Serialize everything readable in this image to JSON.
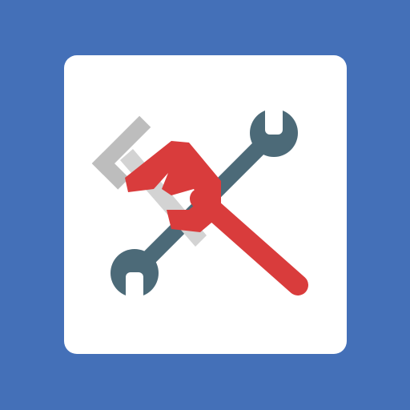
{
  "icon": {
    "name": "tools",
    "depicts": [
      "pipe-wrench-icon",
      "combination-wrench-icon"
    ],
    "colors": {
      "background": "#4470B8",
      "card": "#FFFFFF",
      "wrench": "#4C6A78",
      "pipe_wrench_body": "#D93C3C",
      "pipe_wrench_jaw": "#BDBDBD",
      "pipe_wrench_jaw_light": "#D3D3D3"
    }
  }
}
